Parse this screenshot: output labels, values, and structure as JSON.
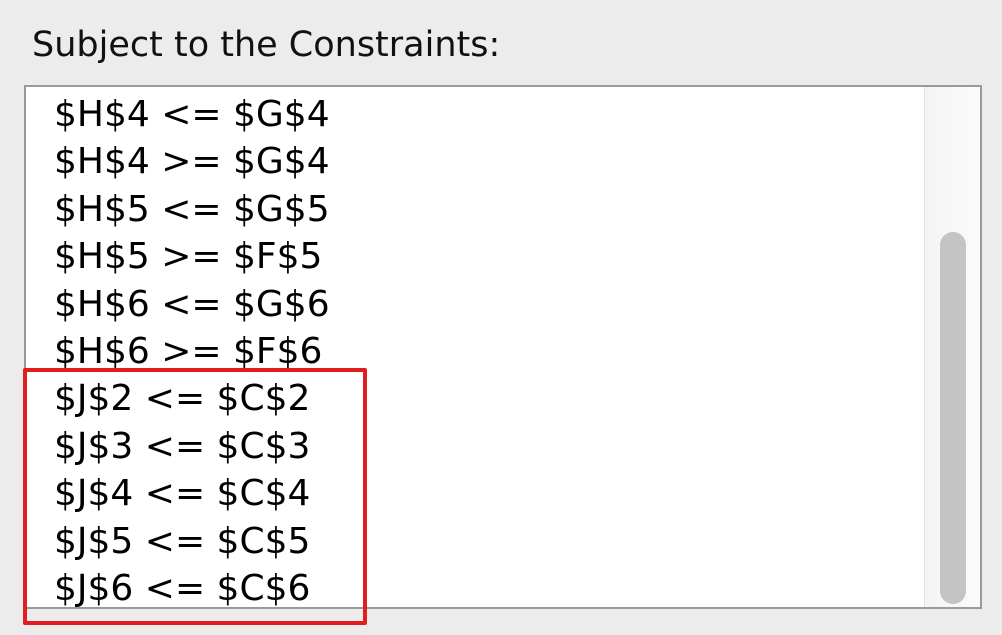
{
  "panel": {
    "title": "Subject to the Constraints:"
  },
  "constraints": [
    "$H$4 <= $G$4",
    "$H$4 >= $G$4",
    "$H$5 <= $G$5",
    "$H$5 >= $F$5",
    "$H$6 <= $G$6",
    "$H$6 >= $F$6",
    "$J$2 <= $C$2",
    "$J$3 <= $C$3",
    "$J$4 <= $C$4",
    "$J$5 <= $C$5",
    "$J$6 <= $C$6"
  ],
  "scrollbar": {
    "position": 0.59,
    "visible_fraction": 0.71
  },
  "highlight": {
    "color": "#e11d1d",
    "from_row": 6,
    "to_row": 10
  }
}
